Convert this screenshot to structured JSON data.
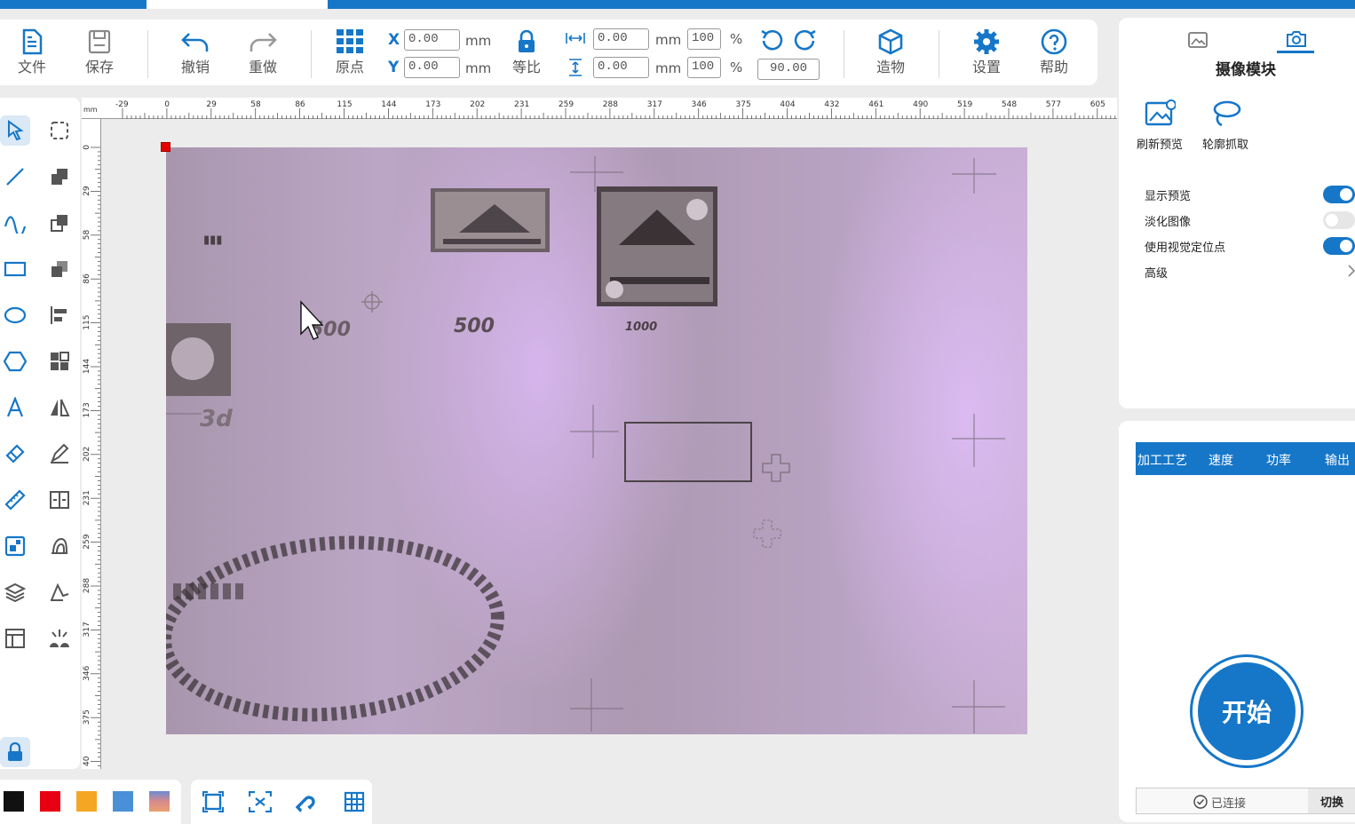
{
  "toolbar": {
    "file": "文件",
    "save": "保存",
    "undo": "撤销",
    "redo": "重做",
    "origin": "原点",
    "x_label": "X",
    "y_label": "Y",
    "x_value": "0.00",
    "y_value": "0.00",
    "unit": "mm",
    "lock_ratio": "等比",
    "width_value": "0.00",
    "height_value": "0.00",
    "width_percent": "100",
    "height_percent": "100",
    "percent": "%",
    "rotation": "90.00",
    "create": "造物",
    "settings": "设置",
    "help": "帮助"
  },
  "ruler": {
    "unit": "mm",
    "h_ticks": [
      "-29",
      "0",
      "29",
      "58",
      "86",
      "115",
      "144",
      "173",
      "202",
      "231",
      "259",
      "288",
      "317",
      "346",
      "375",
      "404",
      "432",
      "461",
      "490",
      "519",
      "548",
      "577",
      "605"
    ],
    "v_ticks": [
      "0",
      "29",
      "58",
      "86",
      "115",
      "144",
      "173",
      "202",
      "231",
      "259",
      "288",
      "317",
      "346",
      "375",
      "40"
    ]
  },
  "camera_panel": {
    "title": "摄像模块",
    "refresh_preview": "刷新预览",
    "contour_capture": "轮廓抓取",
    "options": [
      {
        "label": "显示预览",
        "on": true
      },
      {
        "label": "淡化图像",
        "on": false
      },
      {
        "label": "使用视觉定位点",
        "on": true
      }
    ],
    "advanced": "高级"
  },
  "process_panel": {
    "headers": [
      "加工工艺",
      "速度",
      "功率",
      "输出"
    ],
    "start": "开始",
    "connected": "已连接",
    "switch": "切换"
  },
  "image_text": {
    "label_500a": "500",
    "label_500b": "500",
    "label_1000": "1000",
    "label_3d": "3d"
  },
  "colors": {
    "accent": "#1677c8",
    "swatches": [
      "#111111",
      "#e60012",
      "#f5a623",
      "#4a90d9",
      "gradient"
    ]
  }
}
